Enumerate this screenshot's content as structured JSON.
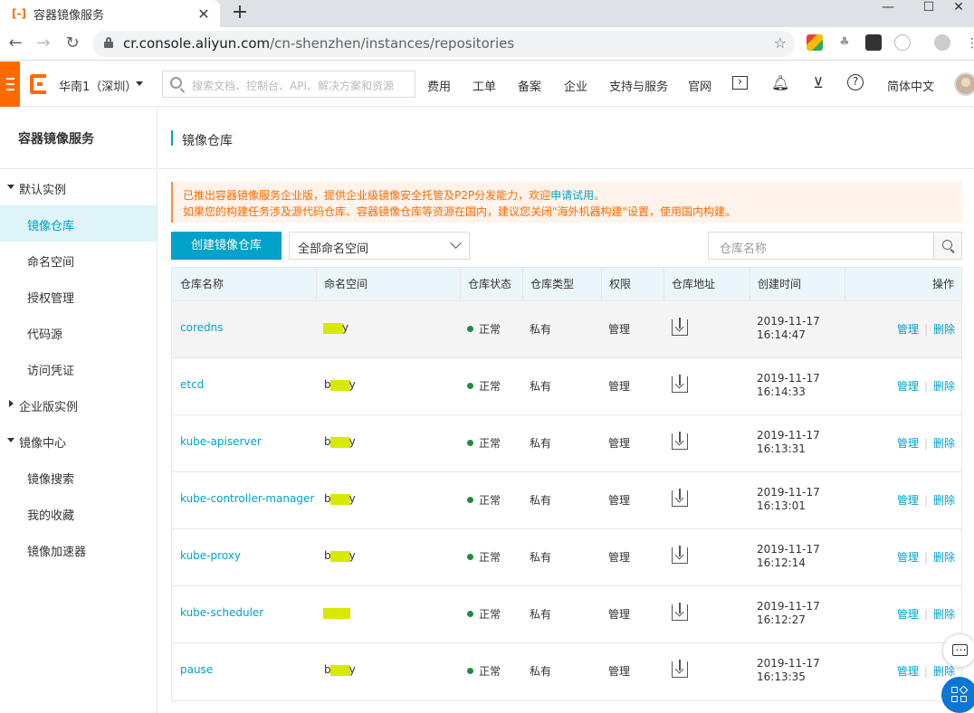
{
  "browser": {
    "tab_title": "容器镜像服务",
    "tab_close": "✕",
    "new_tab": "+",
    "url_host": "cr.console.aliyun.com",
    "url_path": "/cn-shenzhen/instances/repositories",
    "minimize": "—",
    "maximize": "☐",
    "close": "✕"
  },
  "header": {
    "region": "华南1（深圳）",
    "search_placeholder": "搜索文档、控制台、API、解决方案和资源",
    "nav": [
      "费用",
      "工单",
      "备案",
      "企业",
      "支持与服务",
      "官网"
    ],
    "language": "简体中文"
  },
  "sidebar": {
    "title": "容器镜像服务",
    "groups": [
      {
        "label": "默认实例",
        "expanded": true,
        "items": [
          "镜像仓库",
          "命名空间",
          "授权管理",
          "代码源",
          "访问凭证"
        ]
      },
      {
        "label": "企业版实例",
        "expanded": false,
        "items": []
      },
      {
        "label": "镜像中心",
        "expanded": true,
        "items": [
          "镜像搜索",
          "我的收藏",
          "镜像加速器"
        ]
      }
    ],
    "active_item": "镜像仓库"
  },
  "main": {
    "title": "镜像仓库",
    "notice": {
      "line1_prefix": "已推出容器镜像服务企业版，提供企业级镜像安全托管及P2P分发能力，欢迎",
      "line1_link": "申请试用",
      "line1_suffix": "。",
      "line2": "如果您的构建任务涉及源代码仓库、容器镜像仓库等资源在国内，建议您关闭\"海外机器构建\"设置，使用国内构建。"
    },
    "create_button": "创建镜像仓库",
    "namespace_select": "全部命名空间",
    "search_placeholder": "仓库名称"
  },
  "table": {
    "columns": [
      "仓库名称",
      "命名空间",
      "仓库状态",
      "仓库类型",
      "权限",
      "仓库地址",
      "创建时间",
      "操作"
    ],
    "rows": [
      {
        "name": "coredns",
        "ns_prefix": "",
        "ns_suffix": "y",
        "status": "正常",
        "type": "私有",
        "perm": "管理",
        "date": "2019-11-17",
        "time": "16:14:47"
      },
      {
        "name": "etcd",
        "ns_prefix": "b",
        "ns_suffix": "y",
        "status": "正常",
        "type": "私有",
        "perm": "管理",
        "date": "2019-11-17",
        "time": "16:14:33"
      },
      {
        "name": "kube-apiserver",
        "ns_prefix": "b",
        "ns_suffix": "y",
        "status": "正常",
        "type": "私有",
        "perm": "管理",
        "date": "2019-11-17",
        "time": "16:13:31"
      },
      {
        "name": "kube-controller-manager",
        "ns_prefix": "b",
        "ns_suffix": "y",
        "status": "正常",
        "type": "私有",
        "perm": "管理",
        "date": "2019-11-17",
        "time": "16:13:01"
      },
      {
        "name": "kube-proxy",
        "ns_prefix": "b",
        "ns_suffix": "y",
        "status": "正常",
        "type": "私有",
        "perm": "管理",
        "date": "2019-11-17",
        "time": "16:12:14"
      },
      {
        "name": "kube-scheduler",
        "ns_prefix": "",
        "ns_suffix": "",
        "status": "正常",
        "type": "私有",
        "perm": "管理",
        "date": "2019-11-17",
        "time": "16:12:27"
      },
      {
        "name": "pause",
        "ns_prefix": "b",
        "ns_suffix": "y",
        "status": "正常",
        "type": "私有",
        "perm": "管理",
        "date": "2019-11-17",
        "time": "16:13:35"
      }
    ],
    "op_manage": "管理",
    "op_delete": "删除",
    "op_sep": "|"
  },
  "colors": {
    "brand": "#ff6a00",
    "link": "#00a2ca",
    "status_ok": "#1e8e3e"
  }
}
